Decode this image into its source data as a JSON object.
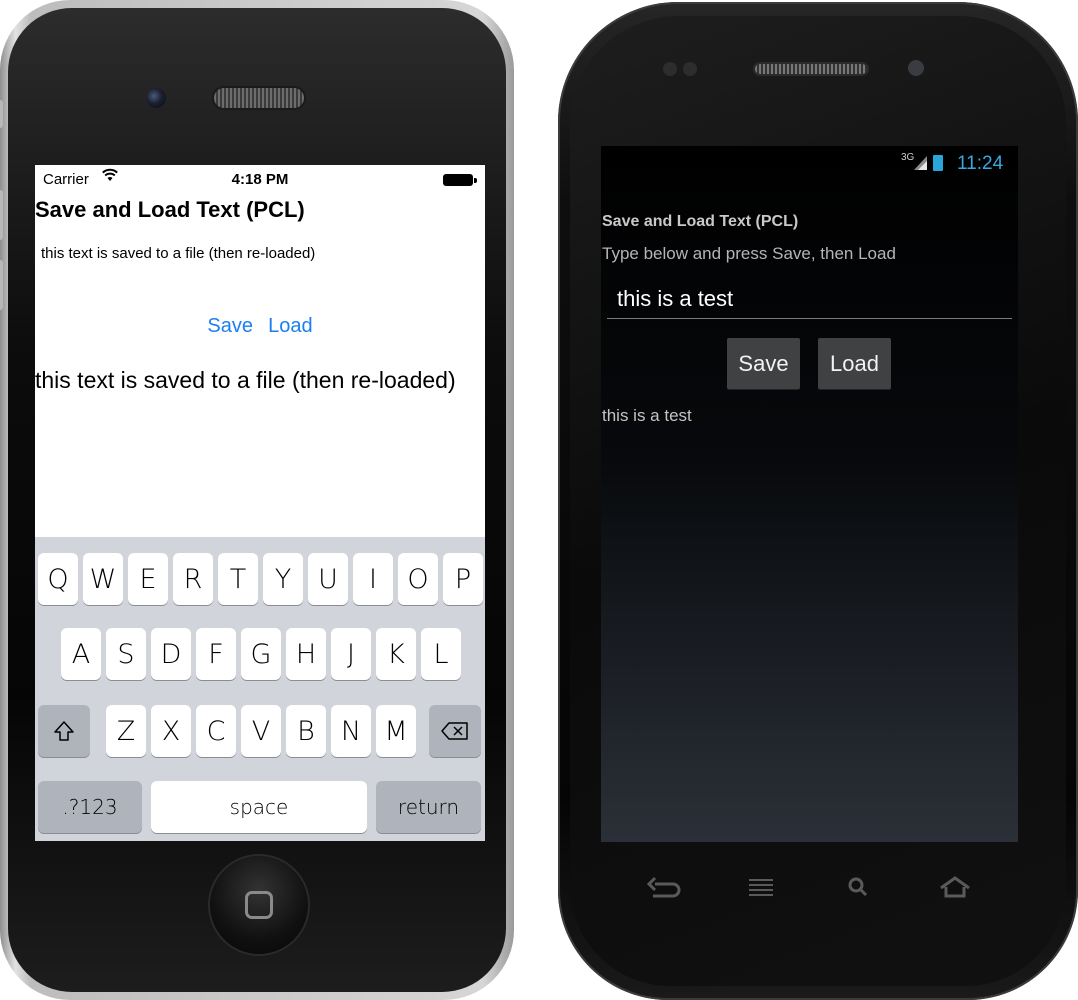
{
  "ios": {
    "status": {
      "carrier": "Carrier",
      "time": "4:18 PM"
    },
    "title": "Save and Load Text (PCL)",
    "input_value": "this text is saved to a file (then re-loaded)",
    "save_label": "Save",
    "load_label": "Load",
    "result_text": "this text is saved to a file (then re-loaded)",
    "keyboard": {
      "row1": [
        "Q",
        "W",
        "E",
        "R",
        "T",
        "Y",
        "U",
        "I",
        "O",
        "P"
      ],
      "row2": [
        "A",
        "S",
        "D",
        "F",
        "G",
        "H",
        "J",
        "K",
        "L"
      ],
      "row3": [
        "Z",
        "X",
        "C",
        "V",
        "B",
        "N",
        "M"
      ],
      "numbers_label": ".?123",
      "space_label": "space",
      "return_label": "return"
    }
  },
  "android": {
    "status": {
      "network": "3G",
      "time": "11:24"
    },
    "title": "Save and Load Text (PCL)",
    "prompt": "Type below and press Save, then Load",
    "input_value": "this is a test",
    "save_label": "Save",
    "load_label": "Load",
    "result_text": "this is a test"
  },
  "colors": {
    "ios_link": "#1a7ff2",
    "android_accent": "#3aa8e0"
  }
}
